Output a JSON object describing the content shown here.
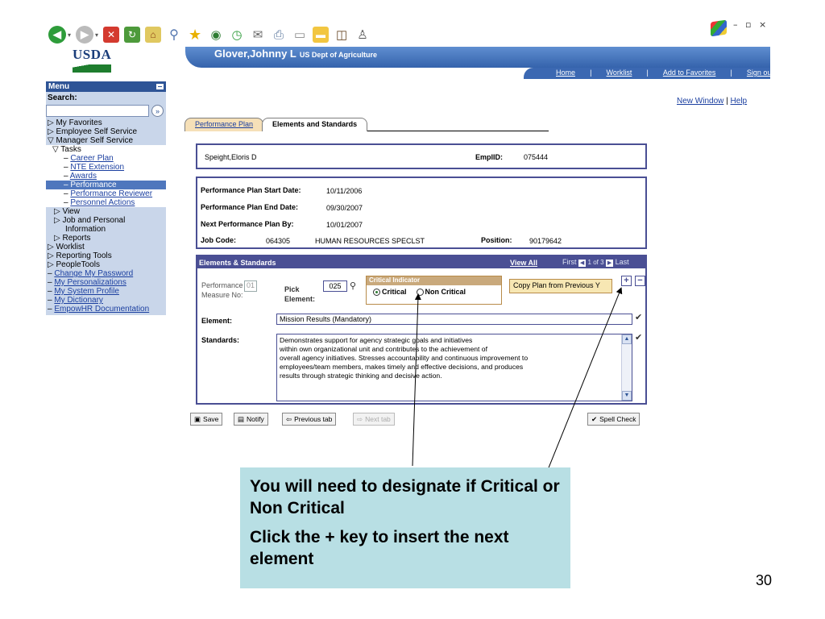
{
  "header": {
    "user_name": "Glover,Johnny L",
    "dept": "US Dept of Agriculture",
    "logo_text": "USDA",
    "nav": [
      "Home",
      "Worklist",
      "Add to Favorites",
      "Sign out"
    ]
  },
  "top_links": {
    "new_window": "New Window",
    "separator": "|",
    "help": "Help"
  },
  "menu": {
    "title": "Menu",
    "search_label": "Search:",
    "search_value": "",
    "go_symbol": "»",
    "items": [
      {
        "label": "▷ My Favorites"
      },
      {
        "label": "▷ Employee Self Service"
      },
      {
        "label": "▽ Manager Self Service"
      },
      {
        "label": "▽ Tasks"
      },
      {
        "label": "Career Plan"
      },
      {
        "label": "NTE Extension"
      },
      {
        "label": "Awards"
      },
      {
        "label": "Performance"
      },
      {
        "label": "Performance Reviewer"
      },
      {
        "label": "Personnel Actions"
      },
      {
        "label": "▷ View"
      },
      {
        "label": "▷ Job and Personal"
      },
      {
        "label": "Information"
      },
      {
        "label": "▷ Reports"
      },
      {
        "label": "▷ Worklist"
      },
      {
        "label": "▷ Reporting Tools"
      },
      {
        "label": "▷ PeopleTools"
      },
      {
        "label": "Change My Password"
      },
      {
        "label": "My Personalizations"
      },
      {
        "label": "My System Profile"
      },
      {
        "label": "My Dictionary"
      },
      {
        "label": "EmpowHR Documentation"
      }
    ]
  },
  "tabs": [
    "Performance Plan",
    "Elements and Standards"
  ],
  "employee": {
    "name": "Speight,Eloris D",
    "emplid_label": "EmplID:",
    "emplid": "075444"
  },
  "plan": {
    "start_label": "Performance Plan Start Date:",
    "start": "10/11/2006",
    "end_label": "Performance Plan End Date:",
    "end": "09/30/2007",
    "next_label": "Next Performance Plan By:",
    "next": "10/01/2007",
    "job_label": "Job Code:",
    "job_code": "064305",
    "job_title": "HUMAN RESOURCES SPECLST",
    "position_label": "Position:",
    "position": "90179642"
  },
  "elements": {
    "title": "Elements & Standards",
    "view_all": "View All",
    "first": "First",
    "count": "1 of 3",
    "last": "Last",
    "perf_label_1": "Performance",
    "perf_label_2": "Measure No:",
    "perf_no": "01",
    "pick_label_1": "Pick",
    "pick_label_2": "Element:",
    "pick_value": "025",
    "critical_header": "Critical Indicator",
    "critical": "Critical",
    "non_critical": "Non Critical",
    "copy_button": "Copy Plan from Previous Y",
    "element_label": "Element:",
    "element_value": "Mission Results (Mandatory)",
    "standards_label": "Standards:",
    "standards_lines": [
      "Demonstrates support for agency strategic goals and initiatives",
      "within own organizational unit and contributes to the achievement of",
      "overall agency initiatives.  Stresses accountability and continuous improvement to",
      "employees/team members, makes timely and effective decisions, and produces",
      "results through strategic thinking and decisive action."
    ]
  },
  "buttons": {
    "save": "Save",
    "notify": "Notify",
    "previous_tab": "Previous tab",
    "next_tab": "Next tab",
    "spell_check": "Spell Check"
  },
  "callout": {
    "line1": "You will need to designate if Critical or Non Critical",
    "line2": "Click the + key to insert the next element"
  },
  "page_number": "30",
  "colors": {
    "header_blue": "#3563ac",
    "box_border": "#4a4f94",
    "menu_bg": "#c9d6ea",
    "callout_bg": "#b8dfe4",
    "tab_inactive": "#f6e0b8"
  }
}
